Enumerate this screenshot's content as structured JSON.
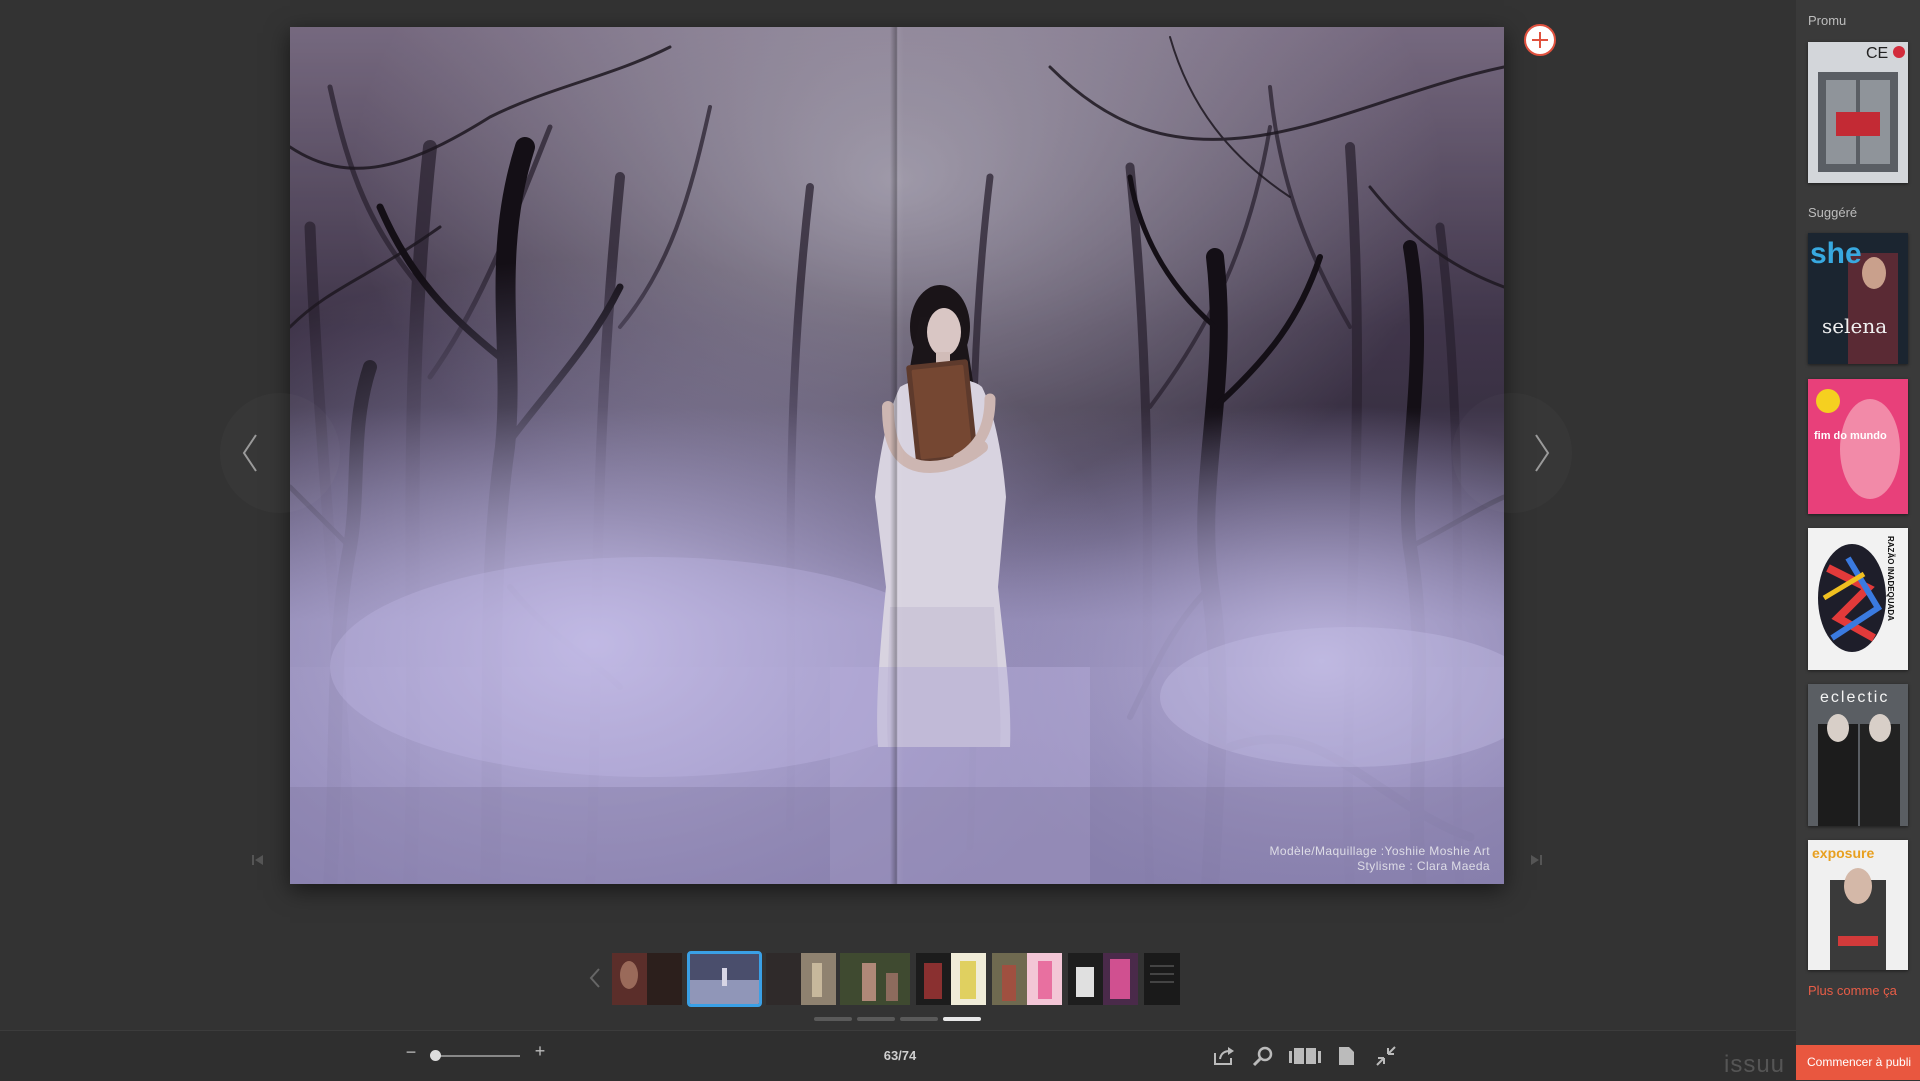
{
  "spread": {
    "credit_line1": "Modèle/Maquillage :Yoshiie Moshie Art",
    "credit_line2": "Stylisme : Clara Maeda"
  },
  "toolbar": {
    "page_counter": "63/74",
    "zoom_out_label": "−",
    "zoom_in_label": "+",
    "brand": "issuu"
  },
  "sidebar": {
    "promoted_heading": "Promu",
    "suggested_heading": "Suggéré",
    "more_link": "Plus comme ça",
    "cta_label": "Commencer à publi",
    "covers": [
      {
        "name": "CEO",
        "title": "CE",
        "bg": "#cfd3d8"
      },
      {
        "name": "she",
        "title": "she",
        "subtitle": "selena",
        "bg": "#1b2530"
      },
      {
        "name": "fim do mundo",
        "title": "fim do mundo",
        "bg": "#e8407a"
      },
      {
        "name": "razão inadequada",
        "title": "RAZÃO INADEQUADA",
        "bg": "#f2f2f2"
      },
      {
        "name": "eclectic",
        "title": "eclectic",
        "bg": "#5a5e63"
      },
      {
        "name": "exposure",
        "title": "exposure",
        "bg": "#f0f0f0"
      }
    ]
  },
  "thumbnails": [
    {
      "colors": [
        "#5b2e2a",
        "#2c1f1c"
      ]
    },
    {
      "colors": [
        "#8a90b0",
        "#3b3f5c"
      ],
      "current": true
    },
    {
      "colors": [
        "#2f2a2a",
        "#a89a80"
      ]
    },
    {
      "colors": [
        "#3f4a30",
        "#a08070"
      ]
    },
    {
      "colors": [
        "#1c1c1c",
        "#e0d060"
      ]
    },
    {
      "colors": [
        "#7a6a50",
        "#e870a0"
      ]
    },
    {
      "colors": [
        "#1e1e1e",
        "#d05090"
      ]
    },
    {
      "colors": [
        "#1a1a1a",
        "#1a1a1a"
      ]
    }
  ],
  "colors": {
    "accent": "#e9573f",
    "current_thumb": "#3aa0e6"
  }
}
